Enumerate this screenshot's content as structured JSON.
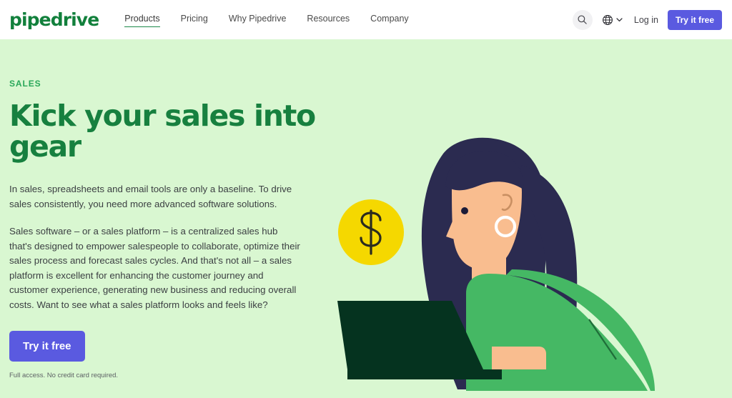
{
  "header": {
    "logo_text": "pipedrive",
    "nav_items": [
      {
        "label": "Products",
        "active": true
      },
      {
        "label": "Pricing",
        "active": false
      },
      {
        "label": "Why Pipedrive",
        "active": false
      },
      {
        "label": "Resources",
        "active": false
      },
      {
        "label": "Company",
        "active": false
      }
    ],
    "search_icon": "search-icon",
    "globe_icon": "globe-icon",
    "chevron_icon": "chevron-down-icon",
    "login_label": "Log in",
    "cta_label": "Try it free"
  },
  "hero": {
    "eyebrow": "SALES",
    "headline": "Kick your sales into gear",
    "paragraph_1": "In sales, spreadsheets and email tools are only a baseline. To drive sales consistently, you need more advanced software solutions.",
    "paragraph_2": "Sales software – or a sales platform – is a centralized sales hub that's designed to empower salespeople to collaborate, optimize their sales process and forecast sales cycles. And that's not all – a sales platform is excellent for enhancing the customer journey and customer experience, generating new business and reducing overall costs. Want to see what a sales platform looks and feels like?",
    "cta_label": "Try it free",
    "fineprint": "Full access. No credit card required."
  },
  "illustration": {
    "name": "woman-with-laptop-and-coin-illustration",
    "coin_symbol": "$",
    "elements": [
      "dollar-coin",
      "woman-figure",
      "laptop",
      "hoop-earring"
    ]
  },
  "colors": {
    "hero_background": "#d9f7d1",
    "header_background": "#ffffff",
    "brand_green": "#12803c",
    "headline_green": "#17803f",
    "eyebrow_green": "#2aa85a",
    "cta_purple": "#5a5ae0",
    "body_text": "#3c4043",
    "coin_yellow": "#f5d800",
    "hair_navy": "#2b2b50",
    "shirt_green": "#45b864",
    "skin_tone": "#f9bd8f",
    "laptop_dark": "#05331f"
  }
}
